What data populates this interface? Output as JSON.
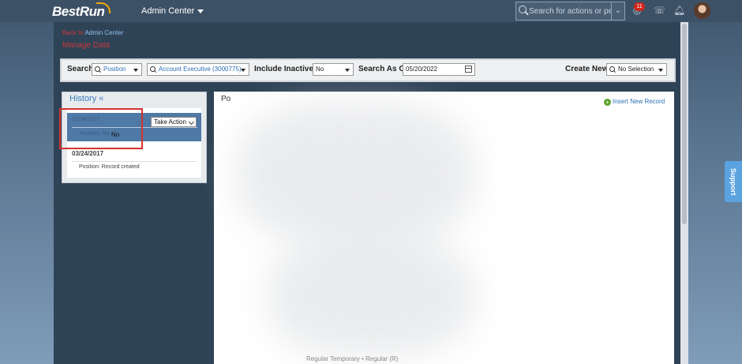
{
  "header": {
    "logo": "BestRun",
    "module": "Admin Center",
    "search_placeholder": "Search for actions or peo...",
    "notification_count": "11",
    "icons": [
      "search-icon",
      "chevron-down-icon",
      "notification-icon",
      "help-icon",
      "bell-icon",
      "avatar"
    ]
  },
  "breadcrumb": {
    "prefix": "Back to",
    "link": "Admin Center"
  },
  "page_title": "Manage Data",
  "filters": {
    "search_label": "Search",
    "search_type": "Position",
    "search_value": "Account Executive (3000775)",
    "inactives_label": "Include Inactives:",
    "inactives_value": "No",
    "as_of_label": "Search As Of:",
    "as_of_value": "05/20/2022",
    "create_new_label": "Create New",
    "create_new_value": "No Selection"
  },
  "history": {
    "title": "History «",
    "selected": {
      "date": "03/24/2017",
      "sub": "Position: No",
      "highlight": "No",
      "action_label": "Take Action"
    },
    "items": [
      {
        "date": "03/24/2017",
        "desc": "Position: Record created"
      }
    ]
  },
  "main": {
    "header_fragment": "Po",
    "insert_label": "Insert New Record",
    "bottom_fragment": "Regular Temporary  •  Regular (R)"
  },
  "support_label": "Support",
  "colors": {
    "accent_red": "#d6322c",
    "link_blue": "#3170b5",
    "selected_row": "#4f79a6"
  }
}
